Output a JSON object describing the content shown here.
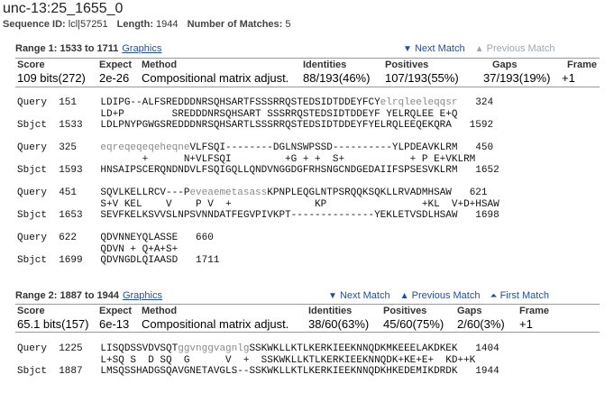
{
  "title": "unc-13:25_1655_0",
  "sequence": {
    "id_label": "Sequence ID:",
    "id_value": "lcl|57251",
    "length_label": "Length:",
    "length_value": "1944",
    "matches_label": "Number of Matches:",
    "matches_value": "5"
  },
  "ranges": [
    {
      "heading": "Range 1: 1533 to 1711",
      "graphics_label": "Graphics",
      "nav": {
        "next": "Next Match",
        "previous": "Previous Match",
        "first": ""
      },
      "stats_headers": [
        "Score",
        "Expect",
        "Method",
        "Identities",
        "Positives",
        "Gaps",
        "Frame"
      ],
      "stats_values": [
        "109 bits(272)",
        "2e-26",
        "Compositional matrix adjust.",
        "88/193(46%)",
        "107/193(55%)",
        "37/193(19%)",
        "+1"
      ],
      "alignment": [
        [
          {
            "t": "Query  151    LDIPG--ALFSREDDDNRSQHSARTFSSSRRQSTEDSIDTDDEYFCY"
          },
          {
            "t": "elrqleeleqqsr",
            "low": true
          },
          {
            "t": "   324"
          }
        ],
        [
          {
            "t": "              LD+P        SREDDDNRSQHSART SSSRRQSTEDSIDTDDEYF YELRQLEE E+Q"
          }
        ],
        [
          {
            "t": "Sbjct  1533   LDLPNYPGWGSREDDDNRSQHSARTLSSSRRQSTEDSIDTDDEYFYELRQLEEQEKQRA   1592"
          }
        ],
        [
          {
            "t": ""
          }
        ],
        [
          {
            "t": "Query  325    "
          },
          {
            "t": "eqreqeqeqeheqne",
            "low": true
          },
          {
            "t": "VLFSQI--------DGLNSWPSSD----------YLPDEAVKLRM   450"
          }
        ],
        [
          {
            "t": "                     +      N+VLFSQI         +G + +  S+           + P E+VKLRM"
          }
        ],
        [
          {
            "t": "Sbjct  1593   HNSAIPSCERQNDNDVLFSQIGQLLQNDVNGGDGFRHSNGCNDGEDAIIFSPSESVKLRM   1652"
          }
        ],
        [
          {
            "t": ""
          }
        ],
        [
          {
            "t": "Query  451    SQVLKELLRCV---P"
          },
          {
            "t": "eveaemetasass",
            "low": true
          },
          {
            "t": "KPNPLEQGLNTPSRQQKSQKLLRVADMHSAW   621"
          }
        ],
        [
          {
            "t": "              S+V KEL    V    P V  +              KP                +KL  V+D+HSAW"
          }
        ],
        [
          {
            "t": "Sbjct  1653   SEVFKELKSVVSLNPSVNNDATFEGVPIVKPT--------------YEKLETVSDLHSAW   1698"
          }
        ],
        [
          {
            "t": ""
          }
        ],
        [
          {
            "t": "Query  622    QDVNNEYQLASSE   660"
          }
        ],
        [
          {
            "t": "              QDVN + Q+A+S+"
          }
        ],
        [
          {
            "t": "Sbjct  1699   QDVNGDLQIAASD   1711"
          }
        ]
      ]
    },
    {
      "heading": "Range 2: 1887 to 1944",
      "graphics_label": "Graphics",
      "nav": {
        "next": "Next Match",
        "previous": "Previous Match",
        "first": "First Match"
      },
      "stats_headers": [
        "Score",
        "Expect",
        "Method",
        "Identities",
        "Positives",
        "Gaps",
        "Frame"
      ],
      "stats_values": [
        "65.1 bits(157)",
        "6e-13",
        "Compositional matrix adjust.",
        "38/60(63%)",
        "45/60(75%)",
        "2/60(3%)",
        "+1"
      ],
      "alignment": [
        [
          {
            "t": "Query  1225   LISQDSSVDVSQT"
          },
          {
            "t": "ggvnggvagnlg",
            "low": true
          },
          {
            "t": "SSKWKLLKTLKERKIEEKNNQDKMKEEELAKDKEK   1404"
          }
        ],
        [
          {
            "t": "              L+SQ S  D SQ  G      V  +  SSKWKLLKTLKERKIEEKNNQDK+KE+E+  KD++K"
          }
        ],
        [
          {
            "t": "Sbjct  1887   LMSQSSHADGSQAVGNETAVGLS--SSKWKLLKTLKERKIEEKNNQDKHKEDEMIKDRDK   1944"
          }
        ]
      ]
    }
  ],
  "colors": {
    "link": "#1f4e9c",
    "disabled_link": "#9aa6b8",
    "lowercase": "#8a8a8a"
  },
  "icons": {
    "next": "down-triangle-icon",
    "previous": "up-triangle-icon",
    "first": "double-up-triangle-icon"
  }
}
